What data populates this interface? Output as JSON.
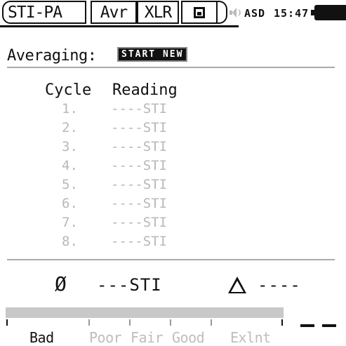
{
  "tabs": [
    {
      "label": "STI-PA"
    },
    {
      "label": "Avr"
    },
    {
      "label": "XLR"
    },
    {
      "label": "save-icon"
    }
  ],
  "status": {
    "mode": "ASD",
    "time": "15:47",
    "icons": [
      "speaker-icon",
      "battery-icon"
    ]
  },
  "averaging": {
    "label": "Averaging:",
    "button_label": "START NEW"
  },
  "table": {
    "headers": {
      "cycle": "Cycle",
      "reading": "Reading"
    },
    "rows": [
      {
        "cycle": "1.",
        "reading": "----STI"
      },
      {
        "cycle": "2.",
        "reading": "----STI"
      },
      {
        "cycle": "3.",
        "reading": "----STI"
      },
      {
        "cycle": "4.",
        "reading": "----STI"
      },
      {
        "cycle": "5.",
        "reading": "----STI"
      },
      {
        "cycle": "6.",
        "reading": "----STI"
      },
      {
        "cycle": "7.",
        "reading": "----STI"
      },
      {
        "cycle": "8.",
        "reading": "----STI"
      }
    ]
  },
  "summary": {
    "average_symbol": "Ø",
    "average_value": "---STI",
    "delta_value": "----"
  },
  "rating": {
    "labels": [
      "Bad",
      "Poor",
      "Fair",
      "Good",
      "Exlnt"
    ]
  },
  "colors": {
    "foreground": "#111111",
    "dimmed": "#b8b8b8",
    "bar": "#c8c8c8",
    "rule": "#aaaaaa"
  }
}
